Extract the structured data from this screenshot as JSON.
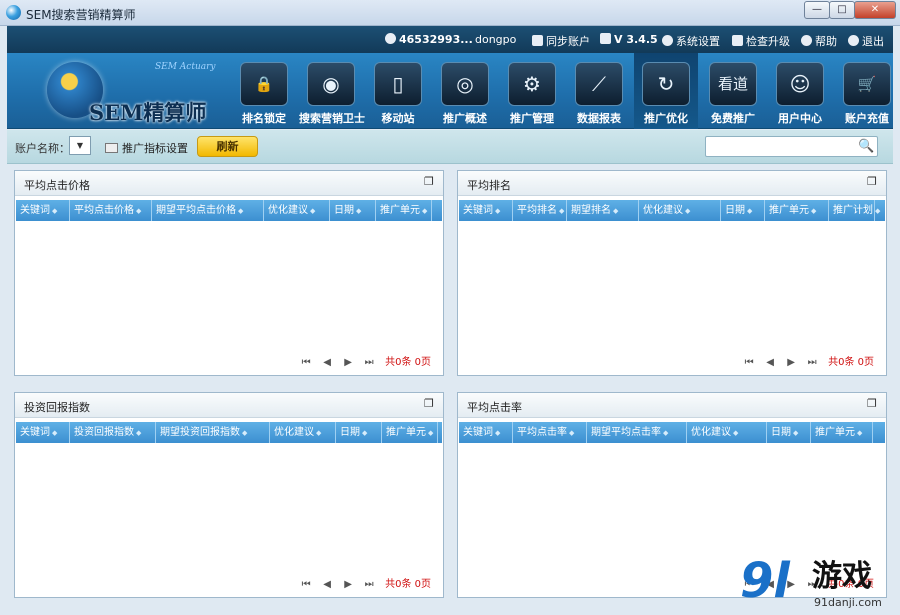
{
  "window": {
    "title": "SEM搜索营销精算师",
    "min": "—",
    "max": "□",
    "close": "✕"
  },
  "topbar": {
    "account_id": "46532993...",
    "username": "dongpo",
    "sync": "同步账户",
    "version": "V 3.4.5",
    "settings": "系统设置",
    "upgrade": "检查升级",
    "help": "帮助",
    "logout": "退出"
  },
  "logo": {
    "sub": "SEM Actuary",
    "main": "SEM精算师"
  },
  "nav": [
    {
      "label": "排名锁定",
      "icon": "lock-icon",
      "glyph": "🔒"
    },
    {
      "label": "搜索营销卫士",
      "icon": "eye-icon",
      "glyph": "◉"
    },
    {
      "label": "移动站",
      "icon": "mobile-icon",
      "glyph": "▯"
    },
    {
      "label": "推广概述",
      "icon": "chart-ring-icon",
      "glyph": "◎"
    },
    {
      "label": "推广管理",
      "icon": "gear-icon",
      "glyph": "⚙"
    },
    {
      "label": "数据报表",
      "icon": "line-chart-icon",
      "glyph": "⟋"
    },
    {
      "label": "推广优化",
      "icon": "refresh-cycle-icon",
      "glyph": "↻"
    },
    {
      "label": "免费推广",
      "icon": "kandao-icon",
      "glyph": "看道"
    },
    {
      "label": "用户中心",
      "icon": "user-icon",
      "glyph": "☺"
    },
    {
      "label": "账户充值",
      "icon": "cart-icon",
      "glyph": "🛒"
    }
  ],
  "toolbar": {
    "account_label": "账户名称：",
    "combo_arrow": "▼",
    "indicator_settings": "推广指标设置",
    "refresh": "刷新",
    "search_value": "",
    "search_icon": "🔍"
  },
  "panels": [
    {
      "title": "平均点击价格",
      "columns": [
        "关键词",
        "平均点击价格",
        "期望平均点击价格",
        "优化建议",
        "日期",
        "推广单元"
      ],
      "pager": {
        "first": "⏮",
        "prev": "◀",
        "next": "▶",
        "last": "⏭",
        "count": "共0条 0页"
      }
    },
    {
      "title": "平均排名",
      "columns": [
        "关键词",
        "平均排名",
        "期望排名",
        "优化建议",
        "日期",
        "推广单元",
        "推广计划"
      ],
      "pager": {
        "first": "⏮",
        "prev": "◀",
        "next": "▶",
        "last": "⏭",
        "count": "共0条 0页"
      }
    },
    {
      "title": "投资回报指数",
      "columns": [
        "关键词",
        "投资回报指数",
        "期望投资回报指数",
        "优化建议",
        "日期",
        "推广单元"
      ],
      "pager": {
        "first": "⏮",
        "prev": "◀",
        "next": "▶",
        "last": "⏭",
        "count": "共0条 0页"
      }
    },
    {
      "title": "平均点击率",
      "columns": [
        "关键词",
        "平均点击率",
        "期望平均点击率",
        "优化建议",
        "日期",
        "推广单元"
      ],
      "pager": {
        "first": "⏮",
        "prev": "◀",
        "next": "▶",
        "last": "⏭",
        "count": "共0条 0页"
      }
    }
  ],
  "watermark": {
    "num": "9l",
    "text": "游戏",
    "url": "91danji.com"
  }
}
